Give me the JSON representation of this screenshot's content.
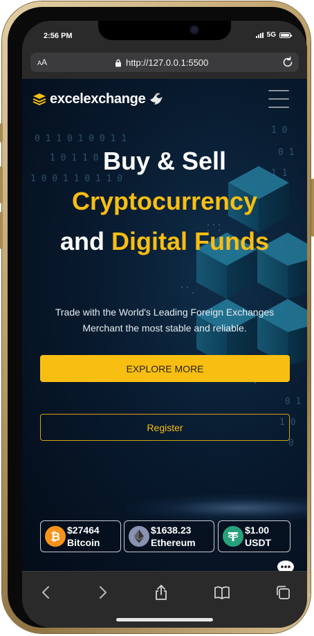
{
  "status_bar": {
    "time": "2:56 PM",
    "network": "5G"
  },
  "browser": {
    "text_size_label_small": "A",
    "text_size_label_large": "A",
    "url": "http://127.0.0.1:5500"
  },
  "site": {
    "logo_text": "excelexchange",
    "hero": {
      "line1": "Buy & Sell",
      "line2": "Cryptocurrency",
      "line3_white": "and",
      "line3_gold": "Digital Funds"
    },
    "description_line1": "Trade with the World's Leading Foreign Exchanges",
    "description_line2": "Merchant the most stable and reliable.",
    "explore_button": "EXPLORE MORE",
    "register_button": "Register",
    "tickers": [
      {
        "price": "$27464",
        "name": "Bitcoin",
        "icon": "bitcoin-icon",
        "color": "#f7931a"
      },
      {
        "price": "$1638.23",
        "name": "Ethereum",
        "icon": "ethereum-icon",
        "color": "#8a92b2"
      },
      {
        "price": "$1.00",
        "name": "USDT",
        "icon": "tether-icon",
        "color": "#26a17b"
      }
    ]
  },
  "colors": {
    "accent": "#f9be12",
    "background": "#06101d",
    "browser_chrome": "#2a2a2b"
  }
}
